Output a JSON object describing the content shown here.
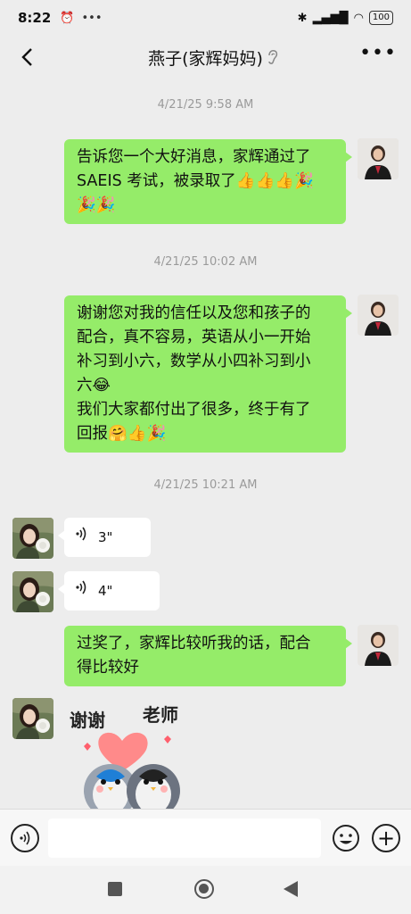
{
  "status_bar": {
    "time": "8:22",
    "battery": "100"
  },
  "header": {
    "title": "燕子(家辉妈妈)"
  },
  "messages": [
    {
      "type": "timestamp",
      "text": "4/21/25 9:58 AM"
    },
    {
      "type": "text",
      "sender": "me",
      "lines": [
        "告诉您一个大好消息，家辉通过了",
        "SAEIS 考试，被录取了👍👍👍🎉",
        "🎉🎉"
      ]
    },
    {
      "type": "timestamp",
      "text": "4/21/25 10:02 AM"
    },
    {
      "type": "text",
      "sender": "me",
      "lines": [
        "谢谢您对我的信任以及您和孩子的",
        "配合，真不容易，英语从小一开始",
        "补习到小六，数学从小四补习到小",
        "六😂",
        "我们大家都付出了很多，终于有了",
        "回报🤗👍🎉"
      ]
    },
    {
      "type": "timestamp",
      "text": "4/21/25 10:21 AM"
    },
    {
      "type": "voice",
      "sender": "them",
      "duration": "3\""
    },
    {
      "type": "voice",
      "sender": "them",
      "duration": "4\""
    },
    {
      "type": "text",
      "sender": "me",
      "lines": [
        "过奖了，家辉比较听我的话，配合",
        "得比较好"
      ]
    },
    {
      "type": "sticker",
      "sender": "them",
      "text_left": "谢谢",
      "text_right": "老师"
    }
  ],
  "colors": {
    "my_bubble": "#95ec69",
    "their_bubble": "#ffffff",
    "background": "#ededed"
  },
  "icons": [
    "back-arrow-icon",
    "ear-icon",
    "more-icon",
    "voice-wave-icon",
    "emoji-icon",
    "plus-icon",
    "nav-square-icon",
    "nav-home-icon",
    "nav-back-icon"
  ]
}
